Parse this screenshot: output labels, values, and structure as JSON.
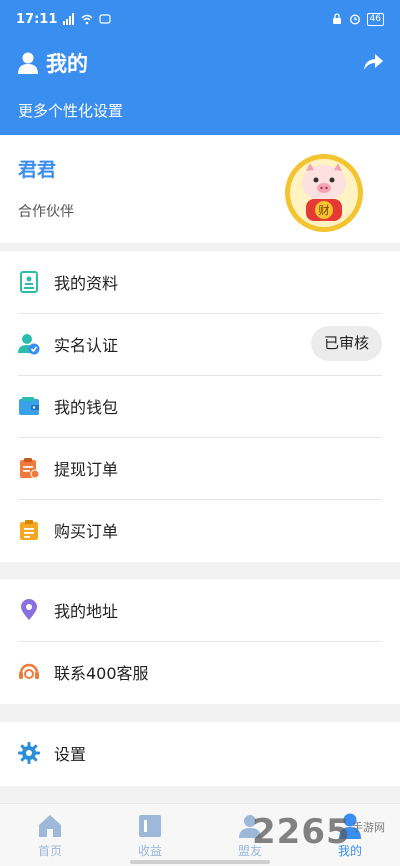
{
  "status_bar": {
    "time": "17:11",
    "battery": "46"
  },
  "header": {
    "title": "我的",
    "subtitle": "更多个性化设置"
  },
  "profile": {
    "name": "君君",
    "role": "合作伙伴",
    "avatar_char": "财"
  },
  "menu_group_1": [
    {
      "label": "我的资料",
      "icon": "profile-document-icon",
      "color": "#2bbcaa"
    },
    {
      "label": "实名认证",
      "icon": "verified-user-icon",
      "color": "#3a8ef0",
      "badge": "已审核"
    },
    {
      "label": "我的钱包",
      "icon": "wallet-icon",
      "color": "#3aa0e8"
    },
    {
      "label": "提现订单",
      "icon": "withdraw-clipboard-icon",
      "color": "#f07a3a"
    },
    {
      "label": "购买订单",
      "icon": "purchase-clipboard-icon",
      "color": "#f5a623"
    }
  ],
  "menu_group_2": [
    {
      "label": "我的地址",
      "icon": "location-pin-icon",
      "color": "#8a6fe0"
    },
    {
      "label": "联系400客服",
      "icon": "customer-service-icon",
      "color": "#f07a3a"
    }
  ],
  "menu_group_3": [
    {
      "label": "设置",
      "icon": "gear-icon",
      "color": "#2a8fd8"
    }
  ],
  "tabbar": [
    {
      "label": "首页",
      "icon": "home-icon"
    },
    {
      "label": "收益",
      "icon": "earnings-icon"
    },
    {
      "label": "盟友",
      "icon": "allies-icon"
    },
    {
      "label": "我的",
      "icon": "me-icon",
      "active": true
    }
  ],
  "watermark": {
    "text": "2265",
    "sub": "手游网"
  },
  "colors": {
    "primary": "#3a8ef0",
    "background": "#f2f2f2"
  }
}
